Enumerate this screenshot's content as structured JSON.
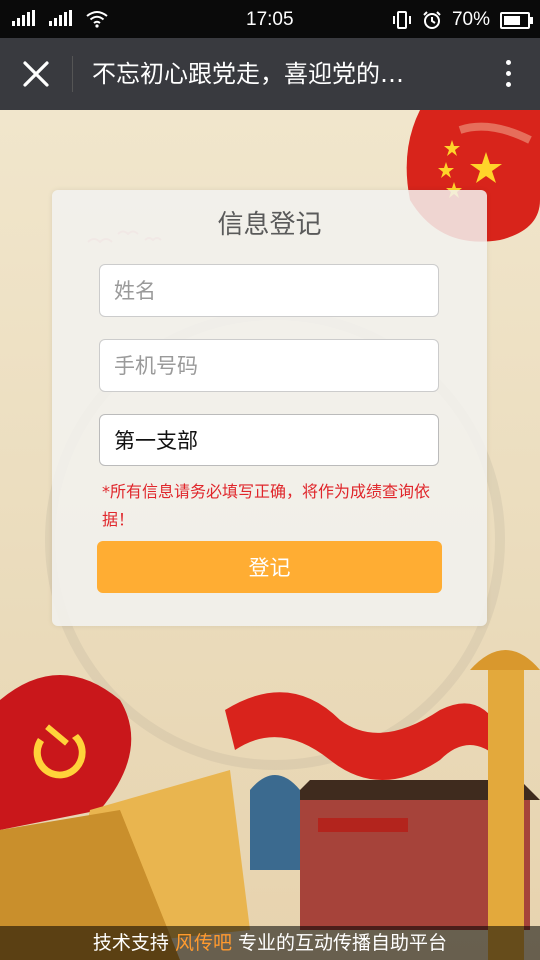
{
  "status_bar": {
    "time": "17:05",
    "battery": "70%"
  },
  "nav": {
    "title": "不忘初心跟党走，喜迎党的…"
  },
  "form": {
    "title": "信息登记",
    "name_placeholder": "姓名",
    "phone_placeholder": "手机号码",
    "branch_value": "第一支部",
    "notice": "*所有信息请务必填写正确，将作为成绩查询依据！",
    "submit_label": "登记"
  },
  "footer": {
    "prefix": "技术支持",
    "brand": "风传吧",
    "suffix": "专业的互动传播自助平台"
  },
  "colors": {
    "accent": "#ffad33",
    "warning": "#e0262b",
    "navbar": "#393a3f",
    "brand": "#ff9a2e"
  }
}
